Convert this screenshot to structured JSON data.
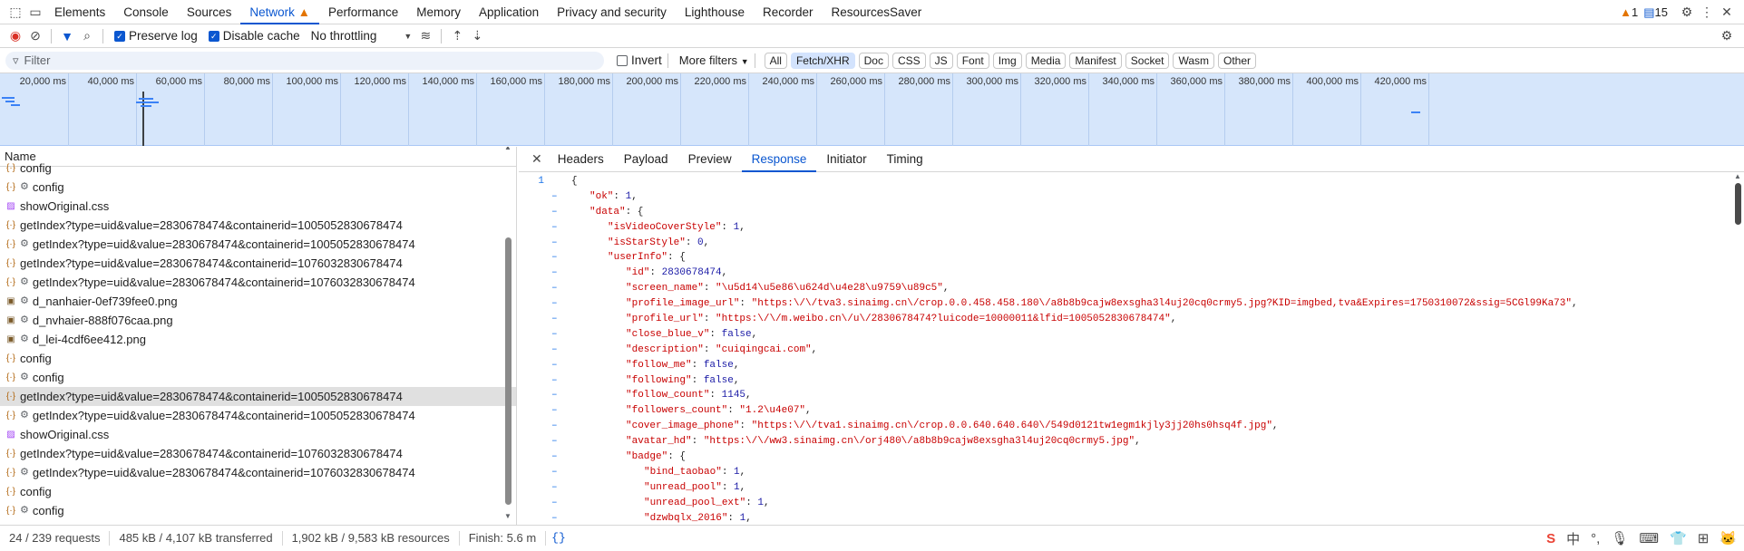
{
  "tabs": [
    "Elements",
    "Console",
    "Sources",
    "Network",
    "Performance",
    "Memory",
    "Application",
    "Privacy and security",
    "Lighthouse",
    "Recorder",
    "ResourcesSaver"
  ],
  "badges": {
    "warnings": "1",
    "messages": "15"
  },
  "toolbar": {
    "preserve_log": "Preserve log",
    "disable_cache": "Disable cache",
    "throttling": "No throttling"
  },
  "filter": {
    "placeholder": "Filter",
    "invert": "Invert",
    "more_filters": "More filters",
    "chips": [
      "All",
      "Fetch/XHR",
      "Doc",
      "CSS",
      "JS",
      "Font",
      "Img",
      "Media",
      "Manifest",
      "Socket",
      "Wasm",
      "Other"
    ]
  },
  "timeline": {
    "ticks": [
      "20,000 ms",
      "40,000 ms",
      "60,000 ms",
      "80,000 ms",
      "100,000 ms",
      "120,000 ms",
      "140,000 ms",
      "160,000 ms",
      "180,000 ms",
      "200,000 ms",
      "220,000 ms",
      "240,000 ms",
      "260,000 ms",
      "280,000 ms",
      "300,000 ms",
      "320,000 ms",
      "340,000 ms",
      "360,000 ms",
      "380,000 ms",
      "400,000 ms",
      "420,000 ms"
    ]
  },
  "list": {
    "header": "Name",
    "rows": [
      {
        "t": "xhr",
        "g": false,
        "n": "config"
      },
      {
        "t": "xhr",
        "g": true,
        "n": "config"
      },
      {
        "t": "css",
        "g": false,
        "n": "showOriginal.css"
      },
      {
        "t": "xhr",
        "g": false,
        "n": "getIndex?type=uid&value=2830678474&containerid=1005052830678474"
      },
      {
        "t": "xhr",
        "g": true,
        "n": "getIndex?type=uid&value=2830678474&containerid=1005052830678474"
      },
      {
        "t": "xhr",
        "g": false,
        "n": "getIndex?type=uid&value=2830678474&containerid=1076032830678474"
      },
      {
        "t": "xhr",
        "g": true,
        "n": "getIndex?type=uid&value=2830678474&containerid=1076032830678474"
      },
      {
        "t": "img",
        "g": true,
        "n": "d_nanhaier-0ef739fee0.png"
      },
      {
        "t": "img",
        "g": true,
        "n": "d_nvhaier-888f076caa.png"
      },
      {
        "t": "img",
        "g": true,
        "n": "d_lei-4cdf6ee412.png"
      },
      {
        "t": "xhr",
        "g": false,
        "n": "config"
      },
      {
        "t": "xhr",
        "g": true,
        "n": "config"
      },
      {
        "t": "xhr",
        "g": false,
        "n": "getIndex?type=uid&value=2830678474&containerid=1005052830678474",
        "sel": true
      },
      {
        "t": "xhr",
        "g": true,
        "n": "getIndex?type=uid&value=2830678474&containerid=1005052830678474"
      },
      {
        "t": "css",
        "g": false,
        "n": "showOriginal.css"
      },
      {
        "t": "xhr",
        "g": false,
        "n": "getIndex?type=uid&value=2830678474&containerid=1076032830678474"
      },
      {
        "t": "xhr",
        "g": true,
        "n": "getIndex?type=uid&value=2830678474&containerid=1076032830678474"
      },
      {
        "t": "xhr",
        "g": false,
        "n": "config"
      },
      {
        "t": "xhr",
        "g": true,
        "n": "config"
      }
    ]
  },
  "detail": {
    "tabs": [
      "Headers",
      "Payload",
      "Preview",
      "Response",
      "Initiator",
      "Timing"
    ],
    "active": "Response"
  },
  "response": [
    {
      "ln": "1",
      "f": "",
      "i": 0,
      "h": "{"
    },
    {
      "ln": "",
      "f": "–",
      "i": 1,
      "h": "<span class=\"k\">\"ok\"</span>: <span class=\"n\">1</span>,"
    },
    {
      "ln": "",
      "f": "–",
      "i": 1,
      "h": "<span class=\"k\">\"data\"</span>: {"
    },
    {
      "ln": "",
      "f": "–",
      "i": 2,
      "h": "<span class=\"k\">\"isVideoCoverStyle\"</span>: <span class=\"n\">1</span>,"
    },
    {
      "ln": "",
      "f": "–",
      "i": 2,
      "h": "<span class=\"k\">\"isStarStyle\"</span>: <span class=\"n\">0</span>,"
    },
    {
      "ln": "",
      "f": "–",
      "i": 2,
      "h": "<span class=\"k\">\"userInfo\"</span>: {"
    },
    {
      "ln": "",
      "f": "–",
      "i": 3,
      "h": "<span class=\"k\">\"id\"</span>: <span class=\"n\">2830678474</span>,"
    },
    {
      "ln": "",
      "f": "–",
      "i": 3,
      "h": "<span class=\"k\">\"screen_name\"</span>: <span class=\"s\">\"\\u5d14\\u5e86\\u624d\\u4e28\\u9759\\u89c5\"</span>,"
    },
    {
      "ln": "",
      "f": "–",
      "i": 3,
      "h": "<span class=\"k\">\"profile_image_url\"</span>: <span class=\"s\">\"https:\\/\\/tva3.sinaimg.cn\\/crop.0.0.458.458.180\\/a8b8b9cajw8exsgha3l4uj20cq0crmy5.jpg?KID=imgbed,tva&Expires=1750310072&ssig=5CGl99Ka73\"</span>,"
    },
    {
      "ln": "",
      "f": "–",
      "i": 3,
      "h": "<span class=\"k\">\"profile_url\"</span>: <span class=\"s\">\"https:\\/\\/m.weibo.cn\\/u\\/2830678474?luicode=10000011&lfid=1005052830678474\"</span>,"
    },
    {
      "ln": "",
      "f": "–",
      "i": 3,
      "h": "<span class=\"k\">\"close_blue_v\"</span>: <span class=\"n\">false</span>,"
    },
    {
      "ln": "",
      "f": "–",
      "i": 3,
      "h": "<span class=\"k\">\"description\"</span>: <span class=\"s\">\"cuiqingcai.com\"</span>,"
    },
    {
      "ln": "",
      "f": "–",
      "i": 3,
      "h": "<span class=\"k\">\"follow_me\"</span>: <span class=\"n\">false</span>,"
    },
    {
      "ln": "",
      "f": "–",
      "i": 3,
      "h": "<span class=\"k\">\"following\"</span>: <span class=\"n\">false</span>,"
    },
    {
      "ln": "",
      "f": "–",
      "i": 3,
      "h": "<span class=\"k\">\"follow_count\"</span>: <span class=\"n\">1145</span>,"
    },
    {
      "ln": "",
      "f": "–",
      "i": 3,
      "h": "<span class=\"k\">\"followers_count\"</span>: <span class=\"s\">\"1.2\\u4e07\"</span>,"
    },
    {
      "ln": "",
      "f": "–",
      "i": 3,
      "h": "<span class=\"k\">\"cover_image_phone\"</span>: <span class=\"s\">\"https:\\/\\/tva1.sinaimg.cn\\/crop.0.0.640.640.640\\/549d0121tw1egm1kjly3jj20hs0hsq4f.jpg\"</span>,"
    },
    {
      "ln": "",
      "f": "–",
      "i": 3,
      "h": "<span class=\"k\">\"avatar_hd\"</span>: <span class=\"s\">\"https:\\/\\/ww3.sinaimg.cn\\/orj480\\/a8b8b9cajw8exsgha3l4uj20cq0crmy5.jpg\"</span>,"
    },
    {
      "ln": "",
      "f": "–",
      "i": 3,
      "h": "<span class=\"k\">\"badge\"</span>: {"
    },
    {
      "ln": "",
      "f": "–",
      "i": 4,
      "h": "<span class=\"k\">\"bind_taobao\"</span>: <span class=\"n\">1</span>,"
    },
    {
      "ln": "",
      "f": "–",
      "i": 4,
      "h": "<span class=\"k\">\"unread_pool\"</span>: <span class=\"n\">1</span>,"
    },
    {
      "ln": "",
      "f": "–",
      "i": 4,
      "h": "<span class=\"k\">\"unread_pool_ext\"</span>: <span class=\"n\">1</span>,"
    },
    {
      "ln": "",
      "f": "–",
      "i": 4,
      "h": "<span class=\"k\">\"dzwbqlx_2016\"</span>: <span class=\"n\">1</span>,"
    }
  ],
  "status": {
    "requests": "24 / 239 requests",
    "transferred": "485 kB / 4,107 kB transferred",
    "resources": "1,902 kB / 9,583 kB resources",
    "finish": "Finish: 5.6 m"
  },
  "tray": [
    "S",
    "中",
    "°,",
    "mic",
    "kbd",
    "shirt",
    "grid",
    "cat"
  ]
}
